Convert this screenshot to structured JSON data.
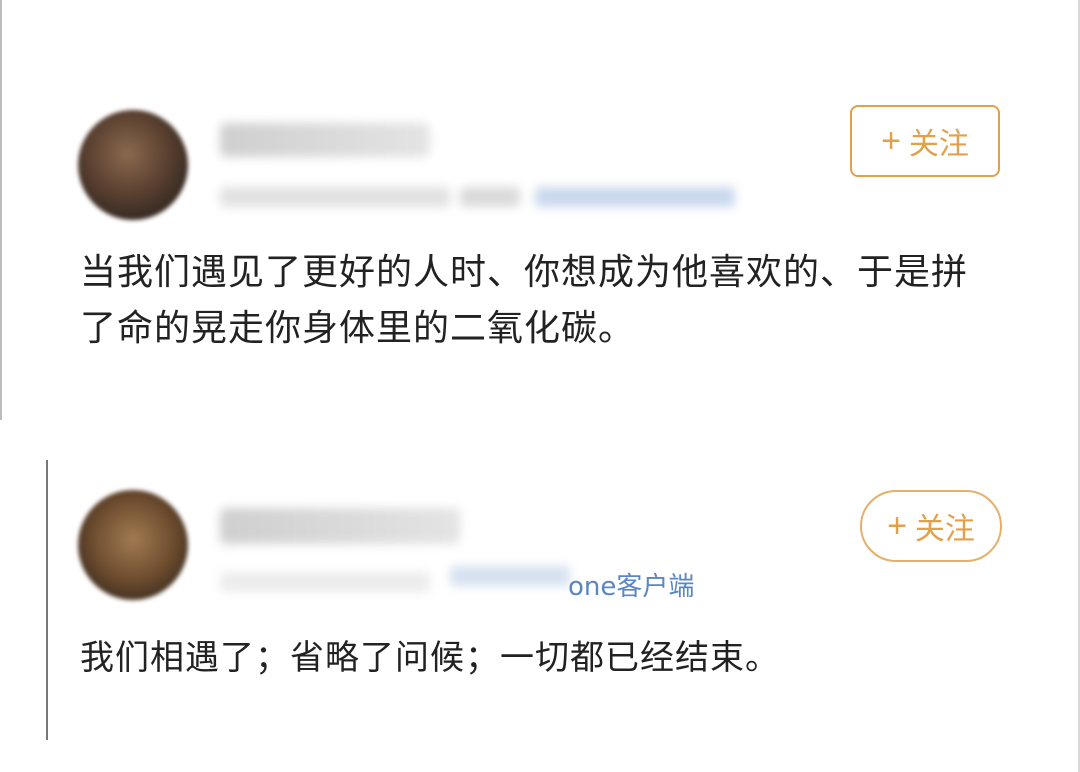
{
  "posts": [
    {
      "follow_label": "关注",
      "comment_text": "当我们遇见了更好的人时、你想成为他喜欢的、于是拼了命的晃走你身体里的二氧化碳。"
    },
    {
      "source_label": "one客户端",
      "follow_label": "关注",
      "comment_text": "我们相遇了；省略了问候；一切都已经结束。"
    }
  ],
  "colors": {
    "accent_orange": "#e1a049",
    "link_blue": "#5b86c4",
    "text": "#222222"
  },
  "icons": {
    "follow": "plus-icon"
  }
}
